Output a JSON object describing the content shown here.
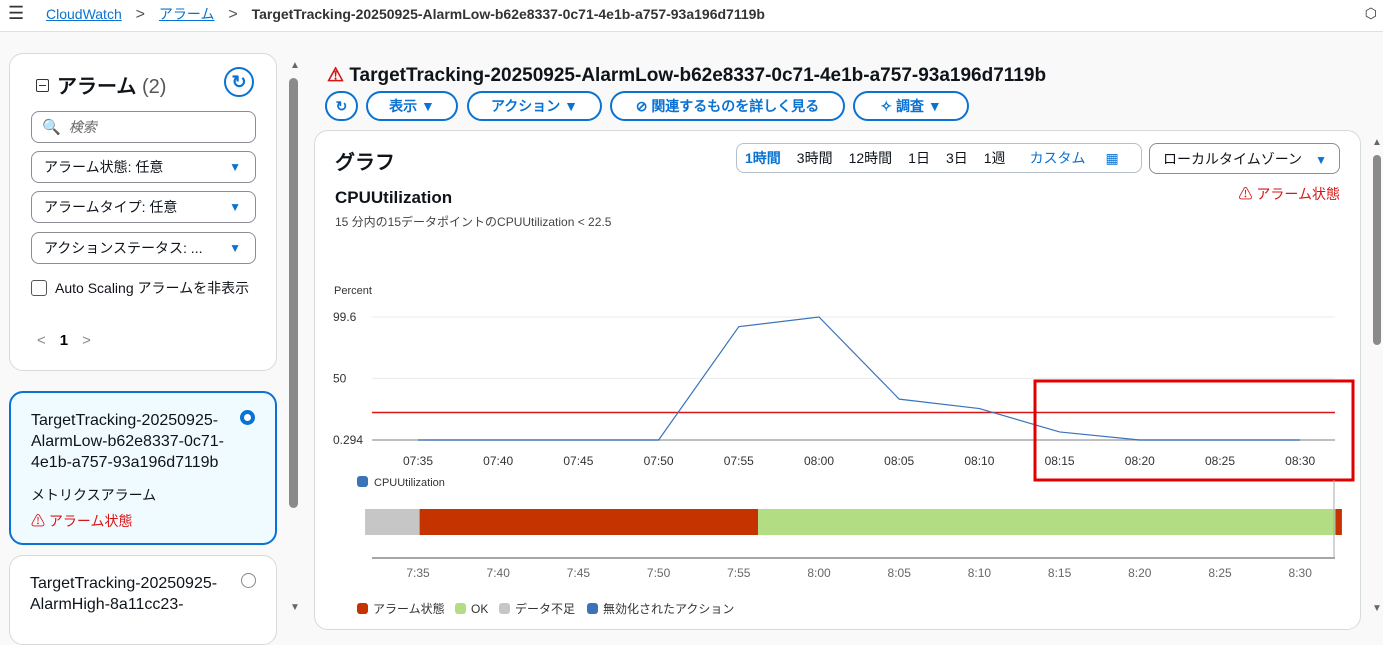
{
  "breadcrumb": {
    "root": "CloudWatch",
    "section": "アラーム",
    "current": "TargetTracking-20250925-AlarmLow-b62e8337-0c71-4e1b-a757-93a196d7119b"
  },
  "sidebar": {
    "title": "アラーム",
    "count": "(2)",
    "search_placeholder": "検索",
    "filters": [
      "アラーム状態: 任意",
      "アラームタイプ: 任意",
      "アクションステータス: ..."
    ],
    "checkbox_label": "Auto Scaling アラームを非表示",
    "page": "1",
    "alarms": [
      {
        "name": "TargetTracking-20250925-AlarmLow-b62e8337-0c71-4e1b-a757-93a196d7119b",
        "type": "メトリクスアラーム",
        "state": "アラーム状態",
        "selected": true
      },
      {
        "name": "TargetTracking-20250925-AlarmHigh-8a11cc23-",
        "selected": false
      }
    ]
  },
  "main": {
    "title": "TargetTracking-20250925-AlarmLow-b62e8337-0c71-4e1b-a757-93a196d7119b",
    "buttons": {
      "view": "表示",
      "actions": "アクション",
      "related": "関連するものを詳しく見る",
      "investigate": "調査"
    },
    "graph_title": "グラフ",
    "time_ranges": [
      "1時間",
      "3時間",
      "12時間",
      "1日",
      "3日",
      "1週"
    ],
    "selected_range": "1時間",
    "custom_label": "カスタム",
    "timezone": "ローカルタイムゾーン",
    "alarm_state_label": "アラーム状態",
    "metric_name": "CPUUtilization",
    "metric_condition": "15 分内の15データポイントのCPUUtilization < 22.5"
  },
  "chart_data": {
    "type": "line",
    "ylabel": "Percent",
    "y_ticks": [
      "99.6",
      "50",
      "0.294"
    ],
    "ylim": [
      0.294,
      99.6
    ],
    "threshold": 22.5,
    "x": [
      "07:35",
      "07:40",
      "07:45",
      "07:50",
      "07:55",
      "08:00",
      "08:05",
      "08:10",
      "08:15",
      "08:20",
      "08:25",
      "08:30"
    ],
    "series": [
      {
        "name": "CPUUtilization",
        "values": [
          0.294,
          0.294,
          0.294,
          0.294,
          91.8,
          99.6,
          33.3,
          25.7,
          6.8,
          0.3,
          0.3,
          0.294
        ]
      }
    ],
    "color": "#3a73b8",
    "threshold_color": "#d91515",
    "state_timeline": {
      "x_labels": [
        "7:35",
        "7:40",
        "7:45",
        "7:50",
        "7:55",
        "8:00",
        "8:05",
        "8:10",
        "8:15",
        "8:20",
        "8:25",
        "8:30"
      ],
      "segments": [
        {
          "state": "insufficient",
          "start_min": -3.3,
          "end_min": 0.1,
          "color": "#c6c6c6"
        },
        {
          "state": "alarm",
          "start_min": 0.1,
          "end_min": 21.2,
          "color": "#c43300"
        },
        {
          "state": "ok",
          "start_min": 21.2,
          "end_min": 57.2,
          "color": "#b2dd82"
        },
        {
          "state": "alarm",
          "start_min": 57.2,
          "end_min": 57.6,
          "color": "#c43300"
        }
      ]
    },
    "legend": [
      {
        "label": "アラーム状態",
        "color": "#c43300"
      },
      {
        "label": "OK",
        "color": "#b2dd82"
      },
      {
        "label": "データ不足",
        "color": "#c6c6c6"
      },
      {
        "label": "無効化されたアクション",
        "color": "#3a73b8"
      }
    ]
  }
}
